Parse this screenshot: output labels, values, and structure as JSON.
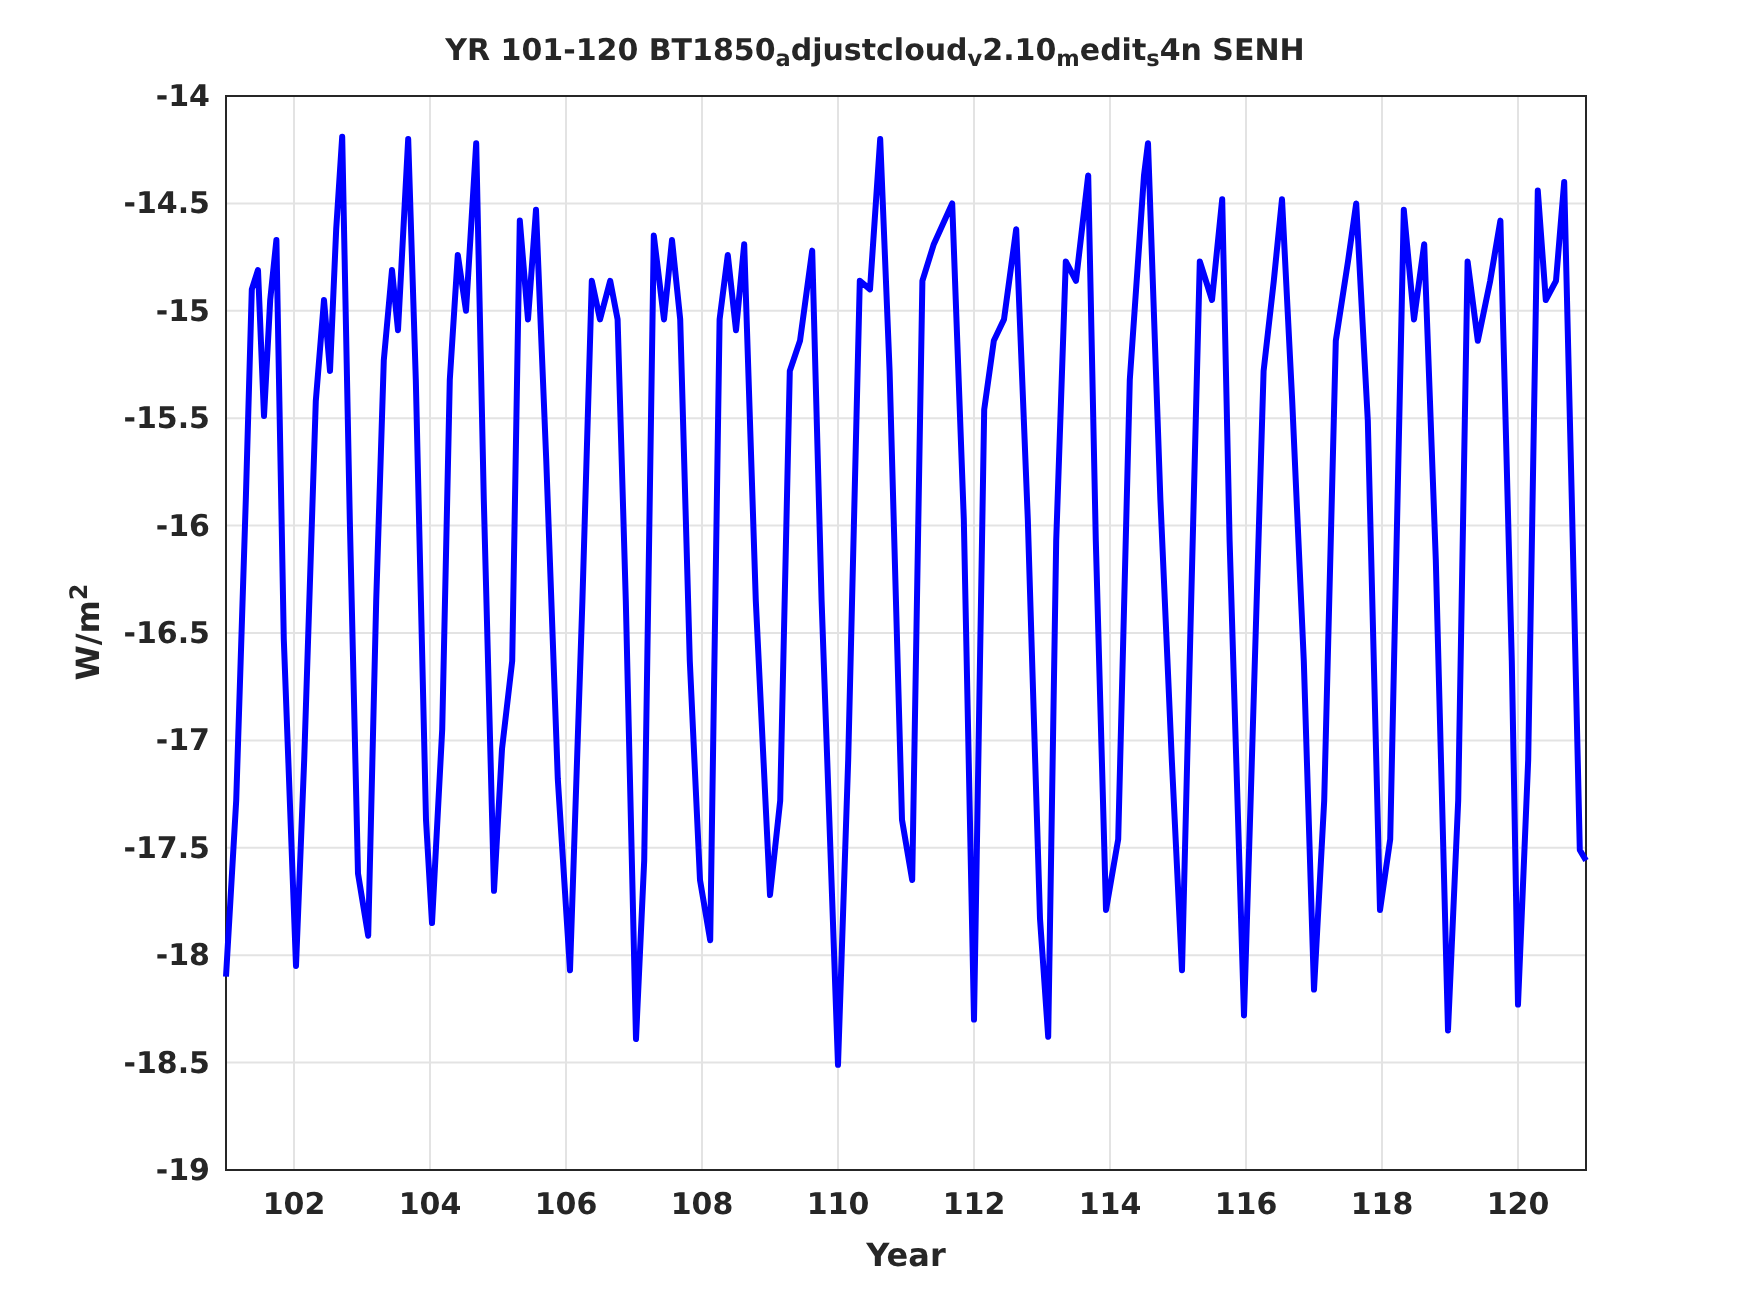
{
  "chart_data": {
    "type": "line",
    "title": "YR 101-120 BT1850$_{a}$djustcloud$_{v}$2.10$_{m}$edit$_{s}$4n SENH",
    "xlabel": "Year",
    "ylabel": "W/m$^{2}$",
    "grid": true,
    "xlim": [
      101,
      121
    ],
    "ylim": [
      -19,
      -14
    ],
    "xticks": [
      102,
      104,
      106,
      108,
      110,
      112,
      114,
      116,
      118,
      120
    ],
    "yticks": [
      -19,
      -18.5,
      -18,
      -17.5,
      -17,
      -16.5,
      -16,
      -15.5,
      -15,
      -14.5,
      -14
    ],
    "x": [
      101.0,
      101.15,
      101.29,
      101.38,
      101.47,
      101.56,
      101.65,
      101.74,
      101.85,
      102.03,
      102.15,
      102.32,
      102.44,
      102.53,
      102.62,
      102.71,
      102.82,
      102.94,
      103.09,
      103.21,
      103.32,
      103.44,
      103.53,
      103.68,
      103.79,
      103.94,
      104.03,
      104.18,
      104.29,
      104.41,
      104.53,
      104.68,
      104.79,
      104.94,
      105.06,
      105.21,
      105.32,
      105.44,
      105.56,
      105.71,
      105.88,
      106.06,
      106.24,
      106.38,
      106.5,
      106.65,
      106.76,
      106.88,
      107.03,
      107.15,
      107.29,
      107.44,
      107.56,
      107.68,
      107.82,
      107.97,
      108.12,
      108.26,
      108.38,
      108.5,
      108.62,
      108.79,
      109.0,
      109.15,
      109.29,
      109.44,
      109.62,
      109.76,
      110.0,
      110.15,
      110.32,
      110.47,
      110.62,
      110.76,
      110.94,
      111.09,
      111.24,
      111.41,
      111.68,
      111.85,
      112.0,
      112.15,
      112.29,
      112.44,
      112.62,
      112.79,
      112.97,
      113.09,
      113.21,
      113.35,
      113.5,
      113.68,
      113.79,
      113.94,
      114.12,
      114.29,
      114.5,
      114.56,
      114.74,
      114.91,
      115.06,
      115.18,
      115.32,
      115.5,
      115.65,
      115.76,
      115.97,
      116.09,
      116.26,
      116.41,
      116.53,
      116.68,
      116.85,
      117.0,
      117.15,
      117.32,
      117.5,
      117.62,
      117.79,
      117.97,
      118.12,
      118.32,
      118.47,
      118.62,
      118.79,
      118.97,
      119.12,
      119.26,
      119.41,
      119.59,
      119.74,
      119.91,
      120.0,
      120.15,
      120.29,
      120.41,
      120.56,
      120.68,
      120.79,
      120.91,
      121.0
    ],
    "series": [
      {
        "color": "#0000ff",
        "values": [
          -18.1,
          -17.28,
          -15.88,
          -14.9,
          -14.81,
          -15.49,
          -14.95,
          -14.67,
          -16.53,
          -18.05,
          -17.09,
          -15.42,
          -14.95,
          -15.28,
          -14.62,
          -14.19,
          -15.97,
          -17.62,
          -17.91,
          -16.35,
          -15.23,
          -14.81,
          -15.09,
          -14.2,
          -15.32,
          -17.37,
          -17.85,
          -16.95,
          -15.32,
          -14.74,
          -15.0,
          -14.22,
          -15.88,
          -17.7,
          -17.04,
          -16.63,
          -14.58,
          -15.04,
          -14.53,
          -15.69,
          -17.18,
          -18.07,
          -16.35,
          -14.86,
          -15.04,
          -14.86,
          -15.04,
          -16.35,
          -18.39,
          -17.56,
          -14.65,
          -15.04,
          -14.67,
          -15.04,
          -16.63,
          -17.65,
          -17.93,
          -15.04,
          -14.74,
          -15.09,
          -14.69,
          -16.35,
          -17.72,
          -17.28,
          -15.28,
          -15.14,
          -14.72,
          -16.35,
          -18.51,
          -17.09,
          -14.86,
          -14.9,
          -14.2,
          -15.28,
          -17.37,
          -17.65,
          -14.86,
          -14.69,
          -14.5,
          -15.97,
          -18.3,
          -15.46,
          -15.14,
          -15.04,
          -14.62,
          -15.97,
          -17.83,
          -18.38,
          -16.07,
          -14.77,
          -14.86,
          -14.37,
          -16.07,
          -17.79,
          -17.46,
          -15.32,
          -14.37,
          -14.22,
          -15.88,
          -17.09,
          -18.07,
          -16.53,
          -14.77,
          -14.95,
          -14.48,
          -16.07,
          -18.28,
          -17.04,
          -15.28,
          -14.86,
          -14.48,
          -15.42,
          -16.63,
          -18.16,
          -17.28,
          -15.14,
          -14.77,
          -14.5,
          -15.51,
          -17.79,
          -17.46,
          -14.53,
          -15.04,
          -14.69,
          -16.16,
          -18.35,
          -17.28,
          -14.77,
          -15.14,
          -14.86,
          -14.58,
          -16.63,
          -18.23,
          -17.09,
          -14.44,
          -14.95,
          -14.86,
          -14.4,
          -15.88,
          -17.51,
          -17.56
        ]
      }
    ]
  }
}
